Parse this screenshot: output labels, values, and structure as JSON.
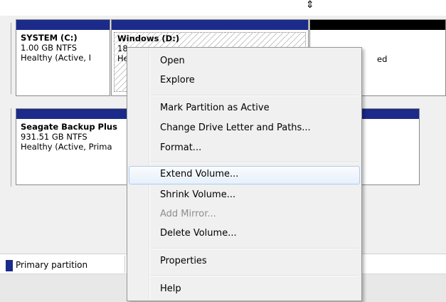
{
  "partitions": {
    "system": {
      "name": "SYSTEM  (C:)",
      "size": "1.00 GB NTFS",
      "status": "Healthy (Active, I"
    },
    "windows": {
      "name": "Windows  (D:)",
      "size": "18",
      "status": "He"
    },
    "unalloc": {
      "status": "ed"
    },
    "seagate": {
      "name": "Seagate Backup Plus",
      "size": "931.51 GB NTFS",
      "status": "Healthy (Active, Prima"
    }
  },
  "legend": {
    "primary_label": "Primary partition",
    "primary_color": "#1c2a8a"
  },
  "context_menu": {
    "items": [
      {
        "label": "Open"
      },
      {
        "label": "Explore"
      },
      {
        "label": "Mark Partition as Active"
      },
      {
        "label": "Change Drive Letter and Paths..."
      },
      {
        "label": "Format..."
      },
      {
        "label": "Extend Volume..."
      },
      {
        "label": "Shrink Volume..."
      },
      {
        "label": "Add Mirror..."
      },
      {
        "label": "Delete Volume..."
      },
      {
        "label": "Properties"
      },
      {
        "label": "Help"
      }
    ]
  }
}
